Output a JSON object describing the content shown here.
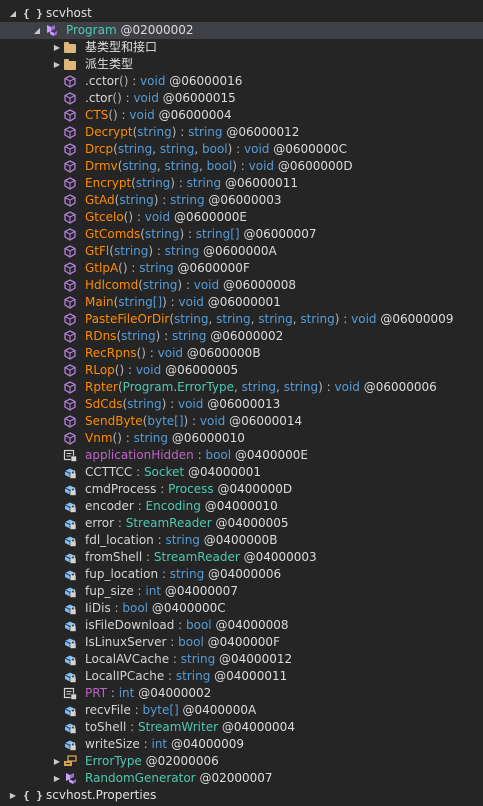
{
  "colors": {
    "background": "#252526",
    "selected_row": "#3f3f46",
    "class_type": "#4ec9b0",
    "keyword": "#569cd6",
    "static_method": "#ff8c00",
    "private_method": "#b8d7a3",
    "namespace": "#e0e0e0",
    "property": "#c586c0",
    "field": "#bd63c5",
    "method_icon": "#b180d7",
    "field_icon": "#75beff",
    "class_icon": "#c8a0ff"
  },
  "tree": {
    "namespace_1": {
      "expander": "◢",
      "icon": "{ }",
      "label": "scvhost"
    },
    "program": {
      "expander": "◢",
      "icon": "class-icon",
      "name": "Program",
      "token": "@02000002"
    },
    "folders": [
      {
        "expander": "▶",
        "icon": "folder-icon",
        "label": "基类型和接口"
      },
      {
        "expander": "▶",
        "icon": "folder-icon",
        "label": "派生类型"
      }
    ],
    "members": [
      {
        "icon": "method-icon",
        "kind": "method",
        "name": ".cctor",
        "params": "()",
        "sep": " : ",
        "type": "void",
        "token": "@06000016"
      },
      {
        "icon": "method-icon",
        "kind": "method",
        "name": ".ctor",
        "params": "()",
        "sep": " : ",
        "type": "void",
        "token": "@06000015"
      },
      {
        "icon": "method-icon",
        "kind": "method-static",
        "name": "CTS",
        "params": "()",
        "sep": " : ",
        "type": "void",
        "token": "@06000004"
      },
      {
        "icon": "method-icon",
        "kind": "method-static",
        "name": "Decrypt",
        "params": "(string)",
        "sep": " : ",
        "type": "string",
        "token": "@06000012"
      },
      {
        "icon": "method-icon",
        "kind": "method-static",
        "name": "Drcp",
        "params": "(string, string, bool)",
        "sep": " : ",
        "type": "void",
        "token": "@0600000C"
      },
      {
        "icon": "method-icon",
        "kind": "method-static",
        "name": "Drmv",
        "params": "(string, string, bool)",
        "sep": " : ",
        "type": "void",
        "token": "@0600000D"
      },
      {
        "icon": "method-icon",
        "kind": "method-static",
        "name": "Encrypt",
        "params": "(string)",
        "sep": " : ",
        "type": "string",
        "token": "@06000011"
      },
      {
        "icon": "method-icon",
        "kind": "method-static",
        "name": "GtAd",
        "params": "(string)",
        "sep": " : ",
        "type": "string",
        "token": "@06000003"
      },
      {
        "icon": "method-icon",
        "kind": "method-static",
        "name": "Gtcelo",
        "params": "()",
        "sep": " : ",
        "type": "void",
        "token": "@0600000E"
      },
      {
        "icon": "method-icon",
        "kind": "method-static",
        "name": "GtComds",
        "params": "(string)",
        "sep": " : ",
        "type": "string[]",
        "token": "@06000007"
      },
      {
        "icon": "method-icon",
        "kind": "method-static",
        "name": "GtFl",
        "params": "(string)",
        "sep": " : ",
        "type": "string",
        "token": "@0600000A"
      },
      {
        "icon": "method-icon",
        "kind": "method-static",
        "name": "GtlpA",
        "params": "()",
        "sep": " : ",
        "type": "string",
        "token": "@0600000F"
      },
      {
        "icon": "method-icon",
        "kind": "method-static",
        "name": "Hdlcomd",
        "params": "(string)",
        "sep": " : ",
        "type": "void",
        "token": "@06000008"
      },
      {
        "icon": "method-icon",
        "kind": "method-static",
        "name": "Main",
        "params": "(string[])",
        "sep": " : ",
        "type": "void",
        "token": "@06000001"
      },
      {
        "icon": "method-icon",
        "kind": "method-static",
        "name": "PasteFileOrDir",
        "params": "(string, string, string, string)",
        "sep": " : ",
        "type": "void",
        "token": "@06000009"
      },
      {
        "icon": "method-icon",
        "kind": "method-static",
        "name": "RDns",
        "params": "(string)",
        "sep": " : ",
        "type": "string",
        "token": "@06000002"
      },
      {
        "icon": "method-icon",
        "kind": "method-static",
        "name": "RecRpns",
        "params": "()",
        "sep": " : ",
        "type": "void",
        "token": "@0600000B"
      },
      {
        "icon": "method-icon",
        "kind": "method-static",
        "name": "RLop",
        "params": "()",
        "sep": " : ",
        "type": "void",
        "token": "@06000005"
      },
      {
        "icon": "method-icon",
        "kind": "method-static",
        "name": "Rpter",
        "params": "(Program.ErrorType, string, string)",
        "sep": " : ",
        "type": "void",
        "token": "@06000006"
      },
      {
        "icon": "method-icon",
        "kind": "method-static",
        "name": "SdCds",
        "params": "(string)",
        "sep": " : ",
        "type": "void",
        "token": "@06000013"
      },
      {
        "icon": "method-icon",
        "kind": "method-static",
        "name": "SendByte",
        "params": "(byte[])",
        "sep": " : ",
        "type": "void",
        "token": "@06000014"
      },
      {
        "icon": "method-icon",
        "kind": "method-static",
        "name": "Vnm",
        "params": "()",
        "sep": " : ",
        "type": "string",
        "token": "@06000010"
      },
      {
        "icon": "property-icon",
        "kind": "property",
        "name": "applicationHidden",
        "params": "",
        "sep": " : ",
        "type": "bool",
        "token": "@0400000E"
      },
      {
        "icon": "field-icon",
        "kind": "field",
        "name": "CCTTCC",
        "params": "",
        "sep": " : ",
        "type": "Socket",
        "token": "@04000001"
      },
      {
        "icon": "field-icon",
        "kind": "field",
        "name": "cmdProcess",
        "params": "",
        "sep": " : ",
        "type": "Process",
        "token": "@0400000D"
      },
      {
        "icon": "field-icon",
        "kind": "field",
        "name": "encoder",
        "params": "",
        "sep": " : ",
        "type": "Encoding",
        "token": "@04000010"
      },
      {
        "icon": "field-icon",
        "kind": "field",
        "name": "error",
        "params": "",
        "sep": " : ",
        "type": "StreamReader",
        "token": "@04000005"
      },
      {
        "icon": "field-icon",
        "kind": "field",
        "name": "fdl_location",
        "params": "",
        "sep": " : ",
        "type": "string",
        "token": "@0400000B"
      },
      {
        "icon": "field-icon",
        "kind": "field",
        "name": "fromShell",
        "params": "",
        "sep": " : ",
        "type": "StreamReader",
        "token": "@04000003"
      },
      {
        "icon": "field-icon",
        "kind": "field",
        "name": "fup_location",
        "params": "",
        "sep": " : ",
        "type": "string",
        "token": "@04000006"
      },
      {
        "icon": "field-icon",
        "kind": "field",
        "name": "fup_size",
        "params": "",
        "sep": " : ",
        "type": "int",
        "token": "@04000007"
      },
      {
        "icon": "field-icon",
        "kind": "field",
        "name": "IiDis",
        "params": "",
        "sep": " : ",
        "type": "bool",
        "token": "@0400000C"
      },
      {
        "icon": "field-icon",
        "kind": "field",
        "name": "isFileDownload",
        "params": "",
        "sep": " : ",
        "type": "bool",
        "token": "@04000008"
      },
      {
        "icon": "field-icon",
        "kind": "field",
        "name": "IsLinuxServer",
        "params": "",
        "sep": " : ",
        "type": "bool",
        "token": "@0400000F"
      },
      {
        "icon": "field-icon",
        "kind": "field",
        "name": "LocalAVCache",
        "params": "",
        "sep": " : ",
        "type": "string",
        "token": "@04000012"
      },
      {
        "icon": "field-icon",
        "kind": "field",
        "name": "LocalIPCache",
        "params": "",
        "sep": " : ",
        "type": "string",
        "token": "@04000011"
      },
      {
        "icon": "property-icon",
        "kind": "property",
        "name": "PRT",
        "params": "",
        "sep": " : ",
        "type": "int",
        "token": "@04000002"
      },
      {
        "icon": "field-icon",
        "kind": "field",
        "name": "recvFile",
        "params": "",
        "sep": " : ",
        "type": "byte[]",
        "token": "@0400000A"
      },
      {
        "icon": "field-icon",
        "kind": "field",
        "name": "toShell",
        "params": "",
        "sep": " : ",
        "type": "StreamWriter",
        "token": "@04000004"
      },
      {
        "icon": "field-icon",
        "kind": "field",
        "name": "writeSize",
        "params": "",
        "sep": " : ",
        "type": "int",
        "token": "@04000009"
      }
    ],
    "nested_types": [
      {
        "expander": "▶",
        "icon": "enum-icon",
        "name": "ErrorType",
        "token": "@02000006"
      },
      {
        "expander": "▶",
        "icon": "class-icon",
        "name": "RandomGenerator",
        "token": "@02000007"
      }
    ],
    "namespace_2": {
      "expander": "▶",
      "icon": "{ }",
      "label": "scvhost.Properties"
    }
  }
}
